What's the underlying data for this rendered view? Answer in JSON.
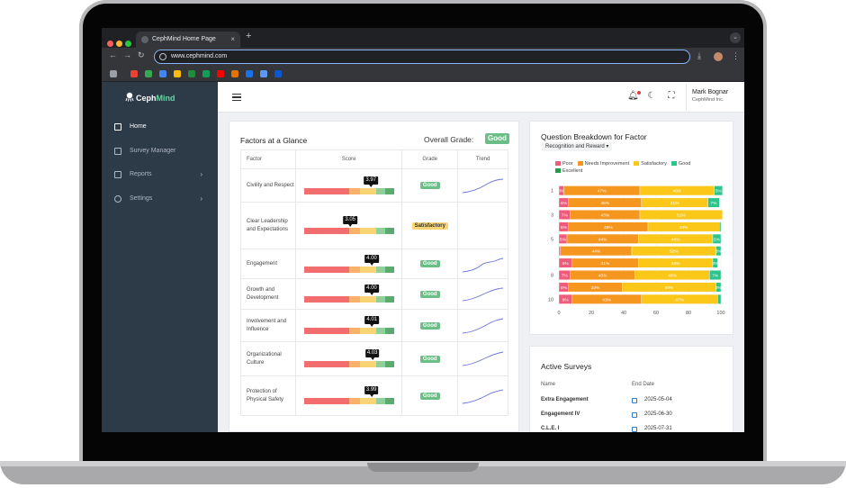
{
  "browser": {
    "tab_title": "CephMind Home Page",
    "new_tab": "+",
    "close_tab": "×",
    "url": "www.cephmind.com"
  },
  "sidebar": {
    "logo_ceph": "Ceph",
    "logo_mind": "Mind",
    "items": [
      {
        "label": "Home",
        "icon": "home-icon",
        "active": true
      },
      {
        "label": "Survey Manager",
        "icon": "clipboard-icon",
        "active": false
      },
      {
        "label": "Reports",
        "icon": "chart-icon",
        "active": false,
        "chevron": "›"
      },
      {
        "label": "Settings",
        "icon": "gear-icon",
        "active": false,
        "chevron": "›"
      }
    ]
  },
  "header": {
    "user_name": "Mark Bognar",
    "user_org": "CephMind Inc."
  },
  "factors": {
    "title": "Factors at a Glance",
    "overall_label": "Overall Grade:",
    "overall_grade": "Good",
    "columns": [
      "Factor",
      "Score",
      "Grade",
      "Trend"
    ],
    "rows": [
      {
        "factor": "Civility and Respect",
        "score": "3.97",
        "score_value": 3.97,
        "grade": "Good",
        "grade_type": "good",
        "trend": true
      },
      {
        "factor": "Clear Leadership and Expectations",
        "score": "3.05",
        "score_value": 3.05,
        "grade": "Satisfactory",
        "grade_type": "sat",
        "trend": false
      },
      {
        "factor": "Engagement",
        "score": "4.00",
        "score_value": 4.0,
        "grade": "Good",
        "grade_type": "good",
        "trend": true
      },
      {
        "factor": "Growth and Development",
        "score": "4.00",
        "score_value": 4.0,
        "grade": "Good",
        "grade_type": "good",
        "trend": true
      },
      {
        "factor": "Involvement and Influence",
        "score": "4.01",
        "score_value": 4.01,
        "grade": "Good",
        "grade_type": "good",
        "trend": true
      },
      {
        "factor": "Organizational Culture",
        "score": "4.03",
        "score_value": 4.03,
        "grade": "Good",
        "grade_type": "good",
        "trend": true
      },
      {
        "factor": "Protection of Physical Safety",
        "score": "3.99",
        "score_value": 3.99,
        "grade": "Good",
        "grade_type": "good",
        "trend": true
      }
    ]
  },
  "breakdown": {
    "title": "Question Breakdown for Factor",
    "selected_factor": "Recognition and Reward",
    "dropdown_caret": "▾"
  },
  "chart_data": {
    "type": "bar",
    "orientation": "horizontal-stacked",
    "title": "",
    "xlim": [
      0,
      100
    ],
    "x_ticks": [
      0,
      20,
      40,
      60,
      80,
      100
    ],
    "y_tick_labels": [
      "1",
      "",
      "3",
      "",
      "5",
      "",
      "",
      "8",
      "",
      "10"
    ],
    "legend_placement": "top",
    "categories": [
      "1",
      "2",
      "3",
      "4",
      "5",
      "6",
      "7",
      "8",
      "9",
      "10"
    ],
    "series": [
      {
        "name": "Poor",
        "color": "#ef5b7b",
        "values": [
          3,
          6,
          7,
          6,
          5,
          1,
          8,
          7,
          6,
          8
        ],
        "labels": [
          "3%",
          "6%",
          "7%",
          "6%",
          "5%",
          "",
          "8%",
          "7%",
          "6%",
          "8%"
        ]
      },
      {
        "name": "Needs Improvement",
        "color": "#f5961f",
        "values": [
          47,
          45,
          43,
          49,
          44,
          44,
          41,
          40,
          33,
          43
        ],
        "labels": [
          "47%",
          "45%",
          "43%",
          "49%",
          "44%",
          "44%",
          "41%",
          "40%",
          "33%",
          "43%"
        ]
      },
      {
        "name": "Satisfactory",
        "color": "#fbc718",
        "values": [
          46,
          41,
          51,
          44,
          46,
          52,
          46,
          46,
          58,
          47
        ],
        "labels": [
          "46%",
          "41%",
          "51%",
          "44%",
          "46%",
          "52%",
          "46%",
          "46%",
          "58%",
          "47%"
        ]
      },
      {
        "name": "Good",
        "color": "#2bc48a",
        "values": [
          5,
          7,
          0,
          1,
          5,
          3,
          3,
          7,
          3,
          2
        ],
        "labels": [
          "5%",
          "7%",
          "",
          "",
          "5%",
          "3%",
          "3%",
          "7%",
          "3%",
          ""
        ]
      },
      {
        "name": "Excellent",
        "color": "#1f9f4a",
        "values": [
          0,
          0,
          0,
          0,
          0,
          0,
          0,
          0,
          0,
          0
        ],
        "labels": [
          "",
          "",
          "",
          "",
          "",
          "",
          "",
          "",
          "",
          ""
        ]
      }
    ]
  },
  "surveys": {
    "title": "Active Surveys",
    "col_name": "Name",
    "col_end": "End Date",
    "rows": [
      {
        "name": "Extra Engagement",
        "end": "2025-05-04"
      },
      {
        "name": "Engagement IV",
        "end": "2025-06-30"
      },
      {
        "name": "C.L.E. I",
        "end": "2025-07-31"
      }
    ]
  },
  "colors": {
    "sidebar_bg": "#2d3a48",
    "accent": "#68d6a8",
    "good": "#6bbf86",
    "satisfactory": "#f8d474"
  }
}
